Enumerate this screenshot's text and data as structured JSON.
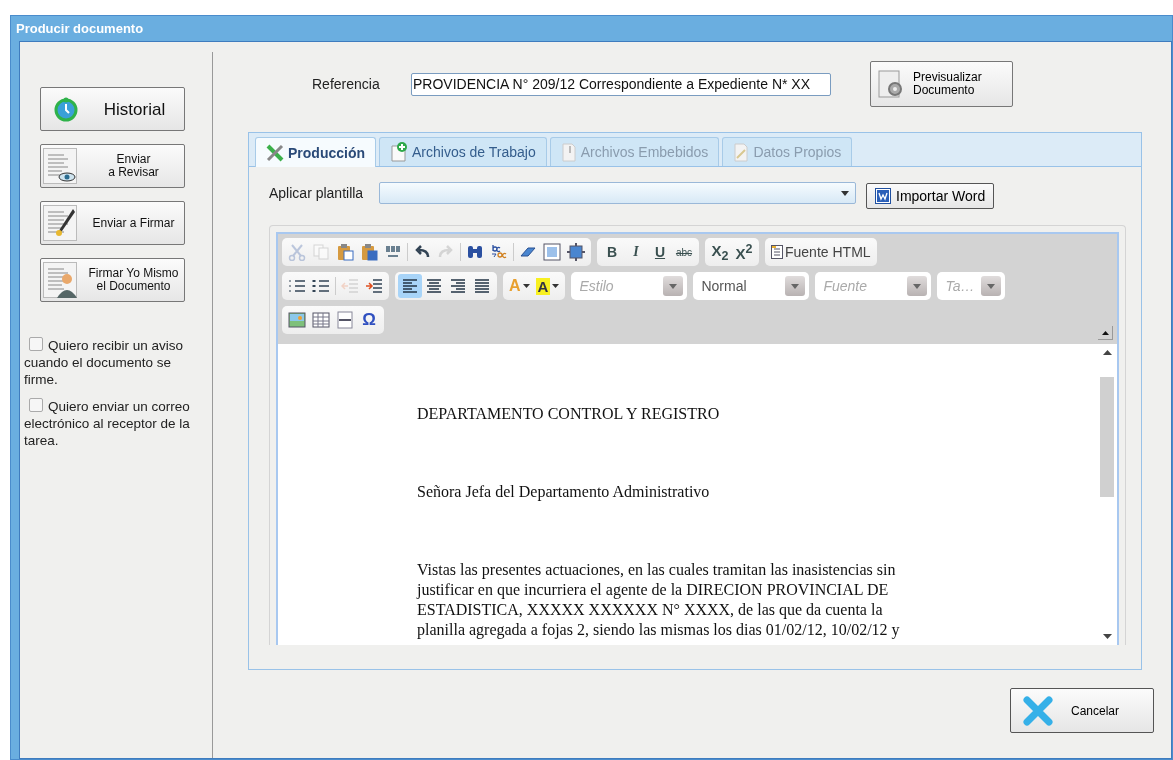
{
  "window": {
    "title": "Producir documento"
  },
  "sidebar": {
    "buttons": [
      {
        "kind": "history",
        "label": "Historial"
      },
      {
        "kind": "review",
        "label": "Enviar\na Revisar"
      },
      {
        "kind": "sign",
        "label": "Enviar a Firmar"
      },
      {
        "kind": "self-sign",
        "label": "Firmar Yo Mismo\nel Documento"
      }
    ],
    "checkboxes": [
      {
        "label": "Quiero recibir un aviso cuando el documento se firme.",
        "checked": false
      },
      {
        "label": "Quiero enviar un correo electrónico al receptor de la tarea.",
        "checked": false
      }
    ]
  },
  "reference": {
    "label": "Referencia",
    "value": "PROVIDENCIA N° 209/12 Correspondiente a Expediente N* XX"
  },
  "preview_button": {
    "label": "Previsualizar\nDocumento"
  },
  "tabs": [
    {
      "kind": "tools",
      "label": "Producción",
      "selected": true,
      "disabled": false
    },
    {
      "kind": "add-file",
      "label": "Archivos de Trabajo",
      "selected": false,
      "disabled": false
    },
    {
      "kind": "attach",
      "label": "Archivos Embebidos",
      "selected": false,
      "disabled": true
    },
    {
      "kind": "edit",
      "label": "Datos Propios",
      "selected": false,
      "disabled": true
    }
  ],
  "template": {
    "label": "Aplicar plantilla"
  },
  "import_button": {
    "label": "Importar Word"
  },
  "toolbar": {
    "rows": [
      {
        "groups": [
          {
            "items": [
              {
                "kind": "cut",
                "disabled": true,
                "selected": false
              },
              {
                "kind": "copy",
                "disabled": true,
                "selected": false
              },
              {
                "kind": "paste",
                "disabled": false,
                "selected": false
              },
              {
                "kind": "paste-word",
                "disabled": false,
                "selected": false
              },
              {
                "kind": "spelling",
                "disabled": false,
                "selected": false
              },
              {
                "kind": "sep"
              },
              {
                "kind": "undo",
                "disabled": false,
                "selected": false
              },
              {
                "kind": "redo",
                "disabled": true,
                "selected": false
              },
              {
                "kind": "sep"
              },
              {
                "kind": "find",
                "disabled": false,
                "selected": false
              },
              {
                "kind": "replace",
                "disabled": false,
                "selected": false
              },
              {
                "kind": "sep"
              },
              {
                "kind": "eraser",
                "disabled": false,
                "selected": false
              },
              {
                "kind": "select-all",
                "disabled": false,
                "selected": false
              },
              {
                "kind": "maximize",
                "disabled": false,
                "selected": false
              }
            ]
          },
          {
            "items": [
              {
                "kind": "bold",
                "label": "B",
                "disabled": false,
                "selected": false
              },
              {
                "kind": "italic",
                "label": "I",
                "disabled": false,
                "selected": false
              },
              {
                "kind": "underline",
                "label": "U",
                "disabled": false,
                "selected": false
              },
              {
                "kind": "strike",
                "label": "abc",
                "disabled": false,
                "selected": false
              }
            ]
          },
          {
            "items": [
              {
                "kind": "script",
                "label": "X$_{2}$",
                "disabled": false,
                "selected": false
              },
              {
                "kind": "script",
                "label": "X$^{2}$",
                "disabled": false,
                "selected": false
              }
            ]
          },
          {
            "items": [
              {
                "kind": "source",
                "label": "Fuente HTML",
                "disabled": false,
                "selected": false
              }
            ]
          }
        ]
      },
      {
        "groups": [
          {
            "items": [
              {
                "kind": "ordered-list",
                "disabled": false,
                "selected": false
              },
              {
                "kind": "bullet-list",
                "disabled": false,
                "selected": false
              },
              {
                "kind": "sep"
              },
              {
                "kind": "outdent",
                "disabled": true,
                "selected": false
              },
              {
                "kind": "indent",
                "disabled": false,
                "selected": false
              }
            ]
          },
          {
            "items": [
              {
                "kind": "align-left",
                "disabled": false,
                "selected": true
              },
              {
                "kind": "align-center",
                "disabled": false,
                "selected": false
              },
              {
                "kind": "align-right",
                "disabled": false,
                "selected": false
              },
              {
                "kind": "justify",
                "disabled": false,
                "selected": false
              }
            ]
          },
          {
            "items": [
              {
                "kind": "text-color",
                "label": "A",
                "disabled": false,
                "selected": false
              },
              {
                "kind": "bg-color",
                "label": "A",
                "disabled": false,
                "selected": false
              }
            ]
          },
          {
            "items": [
              {
                "kind": "combo",
                "placeholder": "Estilo"
              }
            ]
          },
          {
            "items": [
              {
                "kind": "combo",
                "value": "Normal"
              }
            ]
          },
          {
            "items": [
              {
                "kind": "combo",
                "placeholder": "Fuente"
              }
            ]
          },
          {
            "items": [
              {
                "kind": "combo",
                "placeholder": "Ta…"
              }
            ]
          }
        ]
      },
      {
        "groups": [
          {
            "items": [
              {
                "kind": "image",
                "disabled": false,
                "selected": false
              },
              {
                "kind": "table",
                "disabled": false,
                "selected": false
              },
              {
                "kind": "hr",
                "disabled": false,
                "selected": false
              },
              {
                "kind": "special",
                "label": "Ω",
                "disabled": false,
                "selected": false
              }
            ]
          }
        ]
      }
    ]
  },
  "document": {
    "paragraphs": [
      "DEPARTAMENTO CONTROL Y REGISTRO",
      "Señora Jefa del Departamento Administrativo",
      "Vistas las presentes actuaciones, en las cuales tramitan las inasistencias sin\njustificar en que incurriera el agente de la DIRECION PROVINCIAL DE\nESTADISTICA, XXXXX XXXXXX N° XXXX, de las que da cuenta la\nplanilla agregada a fojas 2, siendo las mismas los dias 01/02/12, 10/02/12 y"
    ]
  },
  "cancel_button": {
    "label": "Cancelar"
  }
}
